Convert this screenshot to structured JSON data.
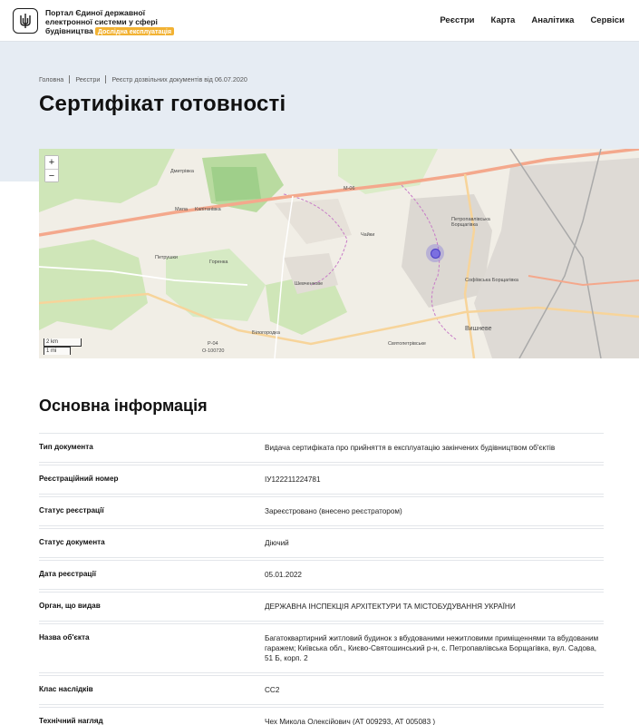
{
  "header": {
    "brand_line1": "Портал Єдиної державної",
    "brand_line2": "електронної системи у сфері",
    "brand_line3": "будівництва",
    "brand_badge": "Дослідна експлуатація",
    "nav": [
      "Реєстри",
      "Карта",
      "Аналітика",
      "Сервіси"
    ]
  },
  "breadcrumb": [
    "Головна",
    "Реєстри",
    "Реєстр дозвільних документів від 06.07.2020"
  ],
  "page_title": "Сертифікат готовності",
  "map": {
    "zoom_in": "+",
    "zoom_out": "−",
    "scale_km": "2 km",
    "scale_mi": "1 mi",
    "labels": [
      "Дмитрівка",
      "Мила",
      "Капітанівка",
      "Петрушки",
      "Горенка",
      "Білогородка",
      "Шевченкове",
      "Чайки",
      "Петропавлівська Борщагівка",
      "Софіївська Борщагівка",
      "Вишневе",
      "Святопетрівське",
      "М-06",
      "Р-04",
      "О-100720"
    ]
  },
  "section_title": "Основна інформація",
  "rows": [
    {
      "key": "Тип документа",
      "value": "Видача сертифіката про прийняття в експлуатацію закінчених будівництвом об'єктів"
    },
    {
      "key": "Реєстраційний номер",
      "value": "ІУ122211224781"
    },
    {
      "key": "Статус реєстрації",
      "value": "Зареєстровано (внесено реєстратором)"
    },
    {
      "key": "Статус документа",
      "value": "Діючий"
    },
    {
      "key": "Дата реєстрації",
      "value": "05.01.2022"
    },
    {
      "key": "Орган, що видав",
      "value": "ДЕРЖАВНА ІНСПЕКЦІЯ АРХІТЕКТУРИ ТА МІСТОБУДУВАННЯ УКРАЇНИ"
    },
    {
      "key": "Назва об'єкта",
      "value": "Багатоквартирний житловий будинок з вбудованими нежитловими приміщеннями та вбудованим гаражем; Київська обл., Києво-Святошинський р-н, с. Петропавлівська Борщагівка, вул. Садова, 51 Б, корп. 2"
    },
    {
      "key": "Клас наслідків",
      "value": "СС2"
    },
    {
      "key": "Технічний нагляд",
      "value": "Чех Микола Олексійович (АТ 009293, АТ 005083 )"
    }
  ]
}
